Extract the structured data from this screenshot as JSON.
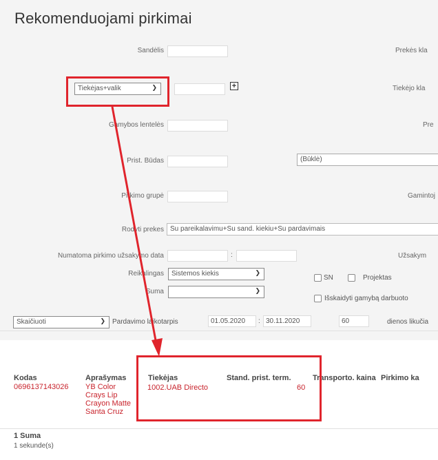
{
  "page": {
    "title": "Rekomenduojami pirkimai"
  },
  "form": {
    "sandelis_label": "Sandėlis",
    "prekes_kl_label": "Prekės kla",
    "tiekejas_select": "Tiekėjas+valik",
    "tiekejo_kl_label": "Tiekėjo kla",
    "gamybos_label": "Gamybos lentelės",
    "pre_label": "Pre",
    "prist_budas_label": "Prist. Būdas",
    "bukle_select": "(Būklė)",
    "pirkimo_grupe_label": "Pirkimo grupė",
    "gamintoj_label": "Gamintoj",
    "rodyti_prekes_label": "Rodyti prekes",
    "rodyti_prekes_value": "Su pareikalavimu+Su sand. kiekiu+Su pardavimais",
    "numatoma_label": "Numatoma pirkimo užsakymo data",
    "numatoma_sep": ":",
    "uzsakym_label": "Užsakym",
    "reikalingas_label": "Reikalingas",
    "reikalingas_select": "Sistemos kiekis",
    "suma_label": "Suma",
    "sn_label": "SN",
    "projektas_label": "Projektas",
    "isskaidyti_label": "Išskaidyti gamybą darbuoto",
    "skaiciuoti_select": "Skaičiuoti",
    "pardavimo_label": "Pardavimo laikotarpis",
    "date_from": "01.05.2020",
    "date_sep": ":",
    "date_to": "30.11.2020",
    "days_value": "60",
    "dienos_label": "dienos likučia"
  },
  "results": {
    "headers": {
      "kodas": "Kodas",
      "aprasymas": "Aprašymas",
      "tiekejas": "Tiekėjas",
      "stand": "Stand. prist. term.",
      "transporto": "Transporto. kaina",
      "pirkimo": "Pirkimo ka"
    },
    "row": {
      "kodas": "0696137143026",
      "aprasymas": [
        "YB Color",
        "Crays Lip",
        "Crayon Matte",
        "Santa Cruz"
      ],
      "tiekejas": "1002.UAB Directo",
      "stand": "60"
    },
    "suma": "1 Suma",
    "timing": "1 sekunde(s)"
  },
  "colors": {
    "annotation": "#e0242c",
    "link": "#c8232c"
  }
}
